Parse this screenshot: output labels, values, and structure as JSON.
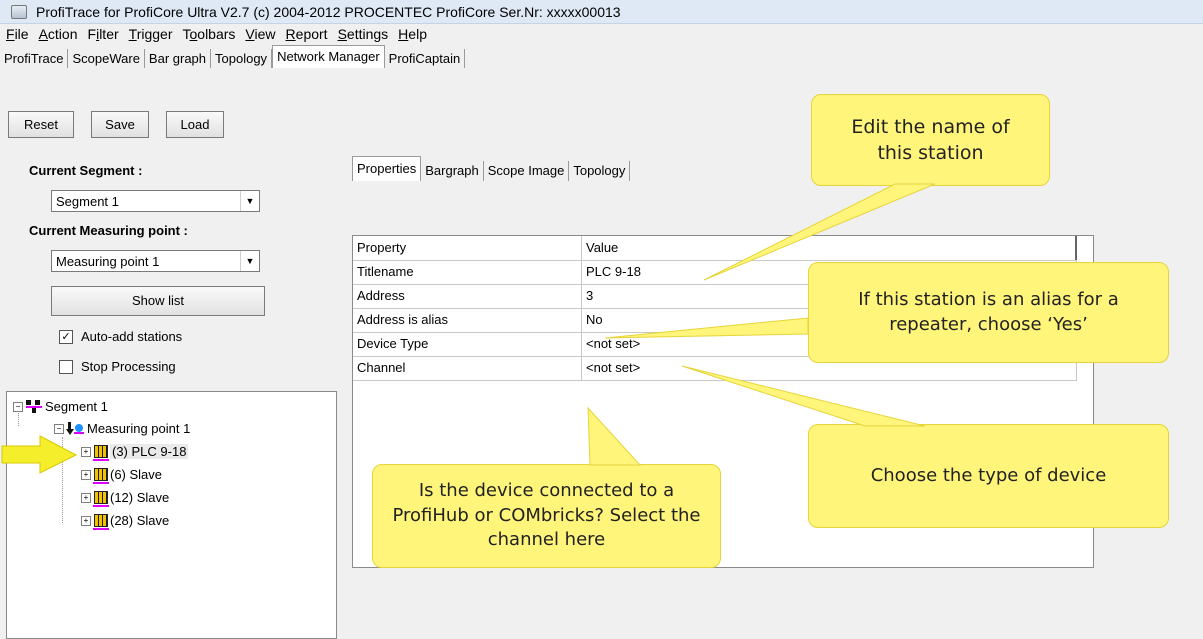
{
  "window": {
    "title": "ProfiTrace for ProfiCore Ultra V2.7 (c) 2004-2012 PROCENTEC  ProfiCore Ser.Nr: xxxxx00013",
    "icon": "app-icon"
  },
  "menubar": {
    "items": [
      {
        "pre": "",
        "ul": "F",
        "post": "ile"
      },
      {
        "pre": "",
        "ul": "A",
        "post": "ction"
      },
      {
        "pre": "F",
        "ul": "i",
        "post": "lter"
      },
      {
        "pre": "",
        "ul": "T",
        "post": "rigger"
      },
      {
        "pre": "T",
        "ul": "o",
        "post": "olbars"
      },
      {
        "pre": "",
        "ul": "V",
        "post": "iew"
      },
      {
        "pre": "",
        "ul": "R",
        "post": "eport"
      },
      {
        "pre": "",
        "ul": "S",
        "post": "ettings"
      },
      {
        "pre": "",
        "ul": "H",
        "post": "elp"
      }
    ]
  },
  "main_tabs": [
    "ProfiTrace",
    "ScopeWare",
    "Bar graph",
    "Topology",
    "Network Manager",
    "ProfiCaptain"
  ],
  "main_tabs_active": "Network Manager",
  "toolbar": {
    "reset": "Reset",
    "save": "Save",
    "load": "Load"
  },
  "left": {
    "segment_label": "Current Segment :",
    "segment_value": "Segment 1",
    "mp_label": "Current Measuring point :",
    "mp_value": "Measuring point 1",
    "show_list": "Show list",
    "auto_add": {
      "label": "Auto-add stations",
      "checked": true,
      "mark": "✓"
    },
    "stop_processing": {
      "label": "Stop Processing",
      "checked": false
    }
  },
  "tree": {
    "segment": "Segment 1",
    "measuring_point": "Measuring point 1",
    "stations": [
      "(3) PLC 9-18",
      "(6) Slave",
      "(12) Slave",
      "(28) Slave"
    ],
    "selected_index": 0,
    "minus": "−",
    "plus": "+"
  },
  "inner_tabs": [
    "Properties",
    "Bargraph",
    "Scope Image",
    "Topology"
  ],
  "inner_tabs_active": "Properties",
  "grid": {
    "headers": [
      "Property",
      "Value"
    ],
    "rows": [
      {
        "property": "Titlename",
        "value": "PLC 9-18"
      },
      {
        "property": "Address",
        "value": "3"
      },
      {
        "property": "Address is alias",
        "value": "No"
      },
      {
        "property": "Device Type",
        "value": "<not set>"
      },
      {
        "property": "Channel",
        "value": "<not set>"
      }
    ]
  },
  "callouts": {
    "edit_name": "Edit the name of this station",
    "alias": "If this station is an alias for a repeater, choose ‘Yes’",
    "device_type": "Choose the type of device",
    "channel": "Is the device connected to a ProfiHub or COMbricks? Select the channel here"
  },
  "colors": {
    "callout_fill": "#fff57a",
    "arrow": "#f5ee2a",
    "tree_pink": "#dd00ff"
  }
}
